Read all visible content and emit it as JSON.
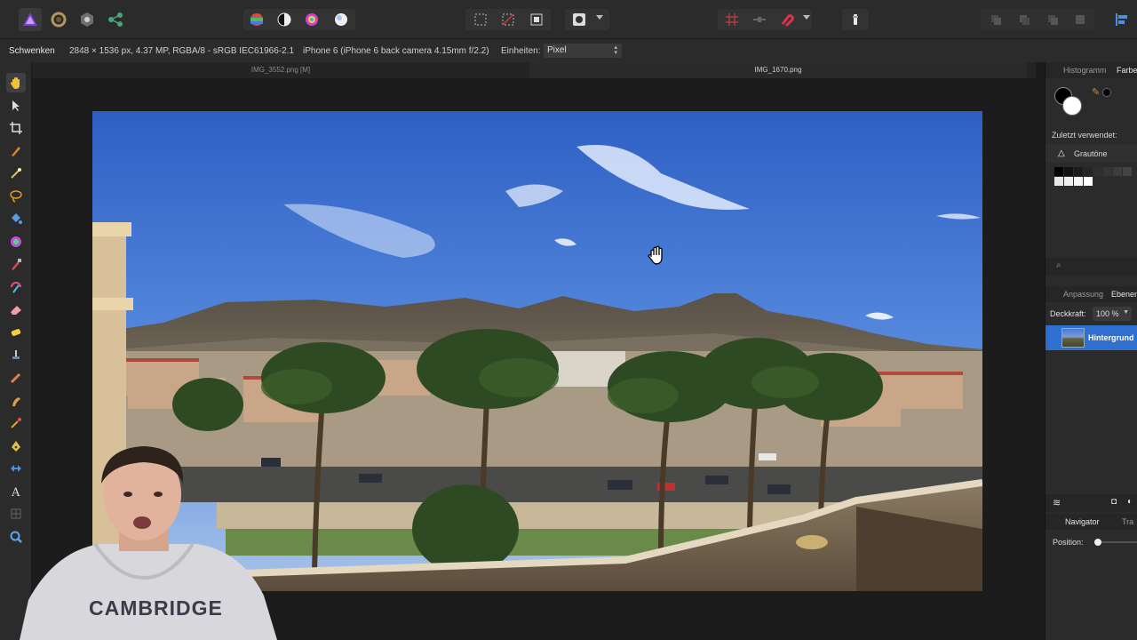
{
  "toolbar": {
    "personas": [
      "photo-persona",
      "liquify-persona",
      "develop-persona",
      "export-persona"
    ],
    "adjust_buttons": [
      "auto-levels",
      "auto-contrast",
      "auto-colors",
      "auto-white-balance"
    ],
    "selection_buttons": [
      "marquee-selection",
      "deselect",
      "invert-selection"
    ],
    "quickmask": "quick-mask",
    "snapping": [
      "grid-snap",
      "align",
      "snapping-magnet"
    ],
    "assistant": "assistant",
    "arrange": [
      "arrange-1",
      "arrange-2",
      "arrange-3",
      "arrange-4"
    ],
    "accent": "#4a90e2"
  },
  "context": {
    "tool_name": "Schwenken",
    "image_info": "2848 × 1536 px, 4.37 MP, RGBA/8 - sRGB IEC61966-2.1",
    "camera": "iPhone 6 (iPhone 6 back camera 4.15mm f/2.2)",
    "units_label": "Einheiten:",
    "units_value": "Pixel"
  },
  "tabs": [
    {
      "label": "IMG_3552.png [M]",
      "active": false
    },
    {
      "label": "IMG_1670.png",
      "active": true
    }
  ],
  "tools": [
    "hand",
    "move",
    "crop",
    "selection-brush",
    "flood-select",
    "freehand-select",
    "fill",
    "gradient",
    "paint-brush",
    "color-replacement",
    "erase",
    "dodge",
    "clone",
    "retouch",
    "smudge",
    "healing",
    "pen",
    "vector-shape",
    "text",
    "mesh-warp",
    "zoom"
  ],
  "panels": {
    "histogram_tab": "Histogramm",
    "color_tab": "Farbe",
    "recent_label": "Zuletzt verwendet:",
    "palette_name": "Grautöne",
    "adjust_tab": "Anpassung",
    "layers_tab": "Ebenen",
    "opacity_label": "Deckkraft:",
    "opacity_value": "100 %",
    "layer_name": "Hintergrund",
    "navigator_tab": "Navigator",
    "transform_tab": "Tra",
    "position_label": "Position:",
    "watermark_text": "CAMBRIDGE"
  }
}
